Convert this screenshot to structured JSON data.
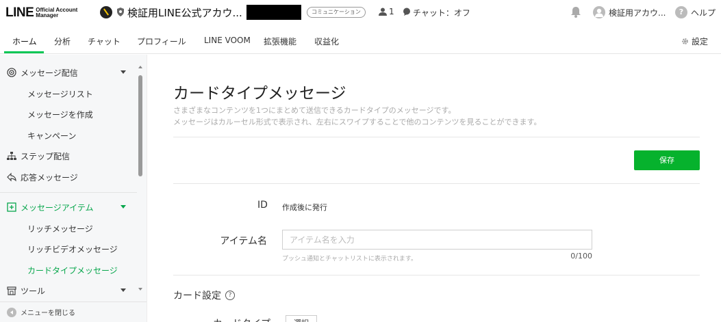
{
  "header": {
    "logo_main": "LINE",
    "logo_sub_1": "Official Account",
    "logo_sub_2": "Manager",
    "account_name": "検証用LINE公式アカウ...",
    "badge": "コミュニケーション",
    "friend_count": "1",
    "chat_status": "チャット：オフ",
    "user_name": "検証用アカウ...",
    "help_label": "ヘルプ",
    "help_glyph": "?"
  },
  "nav": {
    "items": [
      "ホーム",
      "分析",
      "チャット",
      "プロフィール",
      "LINE VOOM",
      "拡張機能",
      "収益化"
    ],
    "settings": "設定",
    "active_color": "#06c755"
  },
  "sidebar": {
    "message_delivery": "メッセージ配信",
    "message_list": "メッセージリスト",
    "create_message": "メッセージを作成",
    "campaign": "キャンペーン",
    "step_delivery": "ステップ配信",
    "auto_reply": "応答メッセージ",
    "message_items": "メッセージアイテム",
    "rich_message": "リッチメッセージ",
    "rich_video_message": "リッチビデオメッセージ",
    "card_type_message": "カードタイプメッセージ",
    "tools": "ツール",
    "close_menu": "メニューを閉じる",
    "accent_color": "#06a64b"
  },
  "main": {
    "title": "カードタイプメッセージ",
    "desc_line1": "さまざまなコンテンツを1つにまとめて送信できるカードタイプのメッセージです。",
    "desc_line2": "メッセージはカルーセル形式で表示され、左右にスワイプすることで他のコンテンツを見ることができます。",
    "save_button": "保存",
    "save_color": "#06b22d",
    "id_label": "ID",
    "id_value": "作成後に発行",
    "item_name_label": "アイテム名",
    "item_name_value": "",
    "item_name_placeholder": "アイテム名を入力",
    "item_name_hint": "プッシュ通知とチャットリストに表示されます。",
    "item_name_counter": "0/100",
    "card_settings": "カード設定",
    "help_glyph": "?",
    "card_type_label": "カードタイプ",
    "select_button": "選択"
  }
}
